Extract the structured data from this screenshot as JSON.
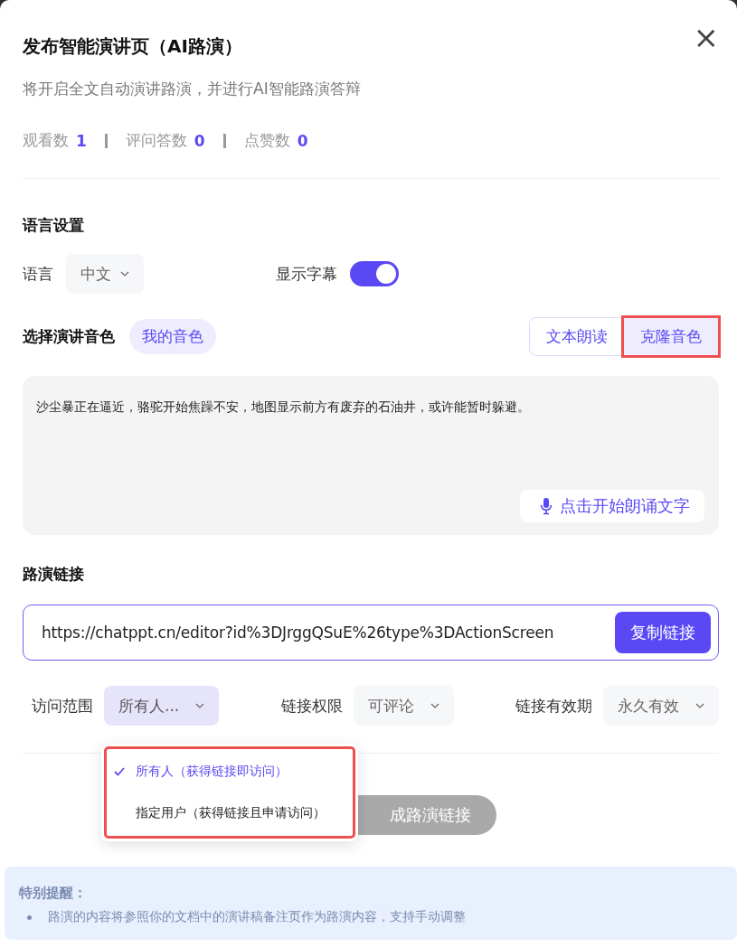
{
  "dialog": {
    "title": "发布智能演讲页（AI路演）",
    "close": "×",
    "subtitle": "将开启全文自动演讲路演，并进行AI智能路演答辩",
    "stats": [
      {
        "label": "观看数",
        "value": "1"
      },
      {
        "label": "评问答数",
        "value": "0"
      },
      {
        "label": "点赞数",
        "value": "0"
      }
    ]
  },
  "language_settings": {
    "heading": "语言设置",
    "language_label": "语言",
    "language_value": "中文",
    "subtitle_label": "显示字幕",
    "subtitle_on": true
  },
  "voice": {
    "heading": "选择演讲音色",
    "my_voice": "我的音色",
    "modes": [
      {
        "label": "文本朗读",
        "selected": false,
        "highlighted": false
      },
      {
        "label": "克隆音色",
        "selected": true,
        "highlighted": true
      }
    ],
    "text": "沙尘暴正在逼近，骆驼开始焦躁不安，地图显示前方有废弃的石油井，或许能暂时躲避。",
    "record_button": "点击开始朗诵文字"
  },
  "link": {
    "heading": "路演链接",
    "url": "https://chatppt.cn/editor?id%3DJrggQSuE%26type%3DActionScreen",
    "copy_button": "复制链接",
    "options": [
      {
        "label": "访问范围",
        "value": "所有人...",
        "open": true
      },
      {
        "label": "链接权限",
        "value": "可评论",
        "open": false
      },
      {
        "label": "链接有效期",
        "value": "永久有效",
        "open": false
      }
    ],
    "dropdown": {
      "highlighted": true,
      "items": [
        {
          "label": "所有人（获得链接即访问）",
          "selected": true
        },
        {
          "label": "指定用户（获得链接且申请访问）",
          "selected": false
        }
      ]
    },
    "generate_button": "成路演链接"
  },
  "notice": {
    "title": "特别提醒：",
    "items": [
      "路演的内容将参照你的文档中的演讲稿备注页作为路演内容，支持手动调整"
    ]
  }
}
